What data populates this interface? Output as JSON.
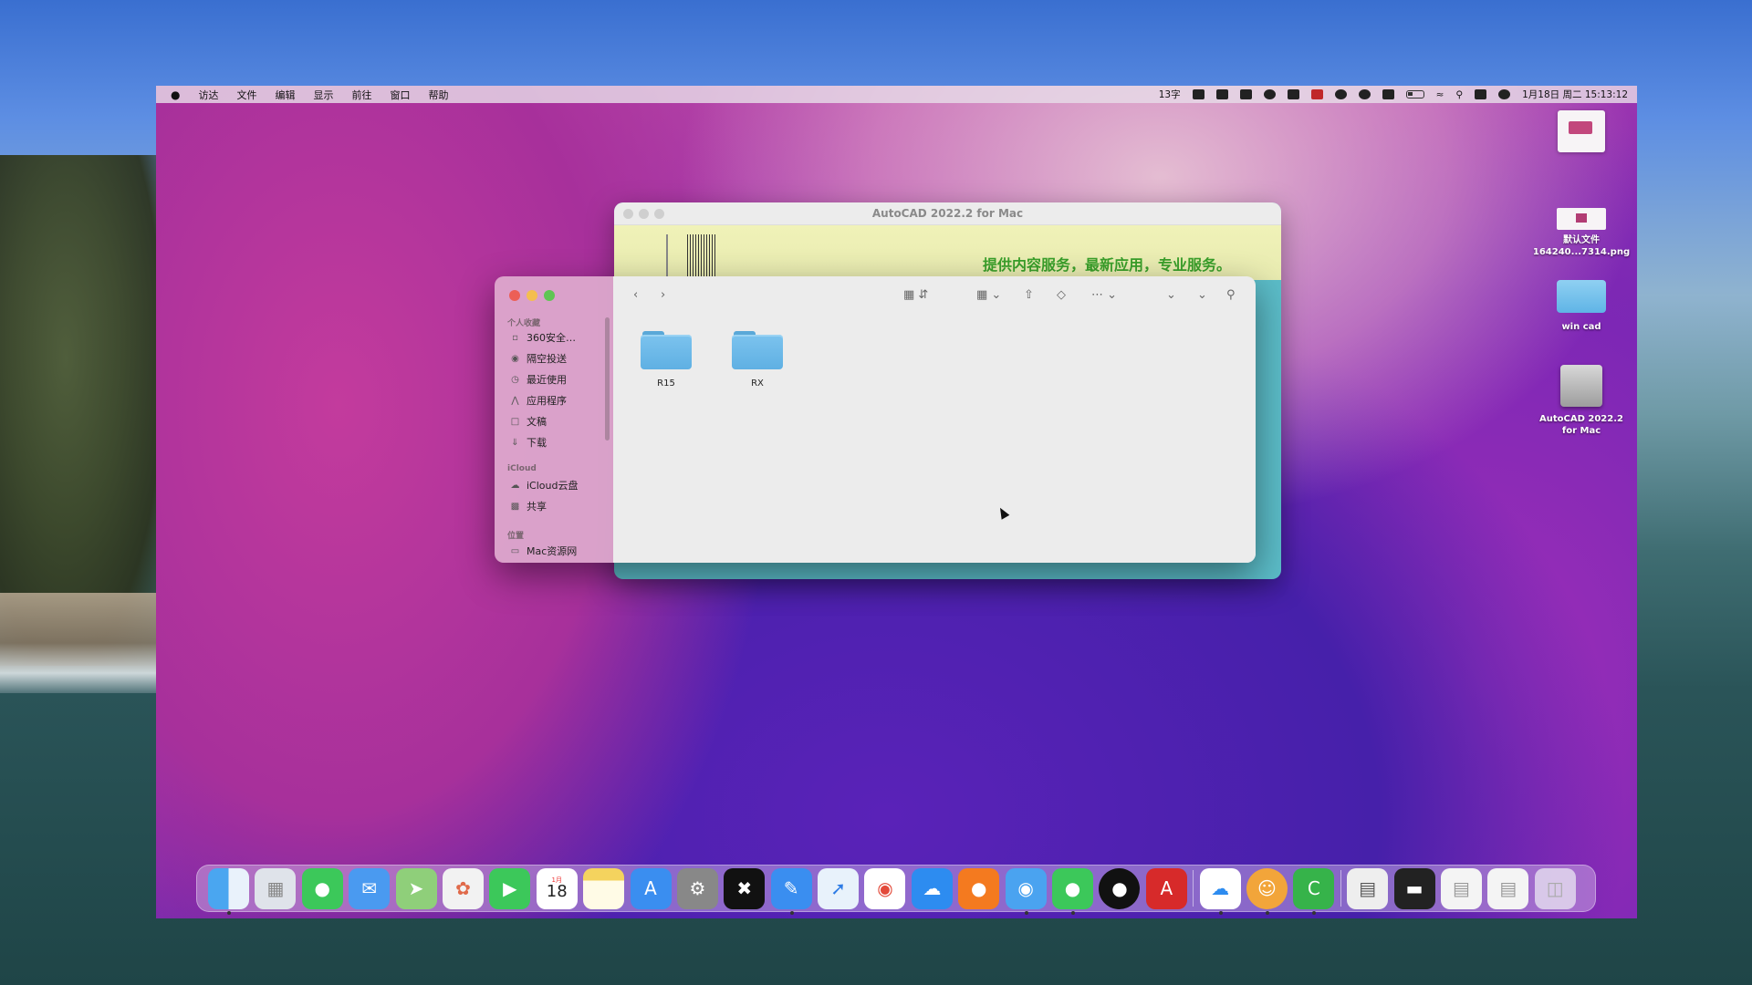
{
  "menubar": {
    "apple": "",
    "items": [
      "访达",
      "文件",
      "编辑",
      "显示",
      "前往",
      "窗口",
      "帮助"
    ],
    "status_text": "13字",
    "clock": "1月18日 周二 15:13:12"
  },
  "back_window": {
    "title": "AutoCAD 2022.2 for Mac",
    "promo": "提供内容服务，最新应用，专业服务。"
  },
  "finder": {
    "sidebar": {
      "favorites_header": "个人收藏",
      "favorites": [
        {
          "label": "360安全…",
          "icon": "folder-icon"
        },
        {
          "label": "隔空投送",
          "icon": "airdrop-icon"
        },
        {
          "label": "最近使用",
          "icon": "clock-icon"
        },
        {
          "label": "应用程序",
          "icon": "apps-icon"
        },
        {
          "label": "文稿",
          "icon": "document-icon"
        },
        {
          "label": "下载",
          "icon": "download-icon"
        }
      ],
      "icloud_header": "iCloud",
      "icloud": [
        {
          "label": "iCloud云盘",
          "icon": "cloud-icon"
        },
        {
          "label": "共享",
          "icon": "shared-folder-icon"
        }
      ],
      "locations_header": "位置",
      "locations": [
        {
          "label": "Mac资源网",
          "icon": "disk-icon"
        }
      ]
    },
    "folders": [
      "R15",
      "RX"
    ]
  },
  "desktop": {
    "screenshot_file": "默认文件\n164240...7314.png",
    "folder": "win cad",
    "disk": "AutoCAD 2022.2\nfor Mac"
  },
  "dock": {
    "calendar_month": "1月",
    "calendar_day": "18",
    "apps": [
      "finder",
      "launchpad",
      "messages",
      "mail",
      "maps",
      "photos",
      "facetime",
      "calendar",
      "notes",
      "app-store",
      "system-preferences",
      "capcut",
      "pen",
      "safari",
      "chrome",
      "baidu-netdisk",
      "firefox",
      "360-browser",
      "wechat",
      "qq",
      "autocad",
      "baidu-cloud",
      "monkey-app",
      "camtasia",
      "preview-doc",
      "terminal",
      "window-thumb-1",
      "window-thumb-2",
      "trash"
    ]
  }
}
